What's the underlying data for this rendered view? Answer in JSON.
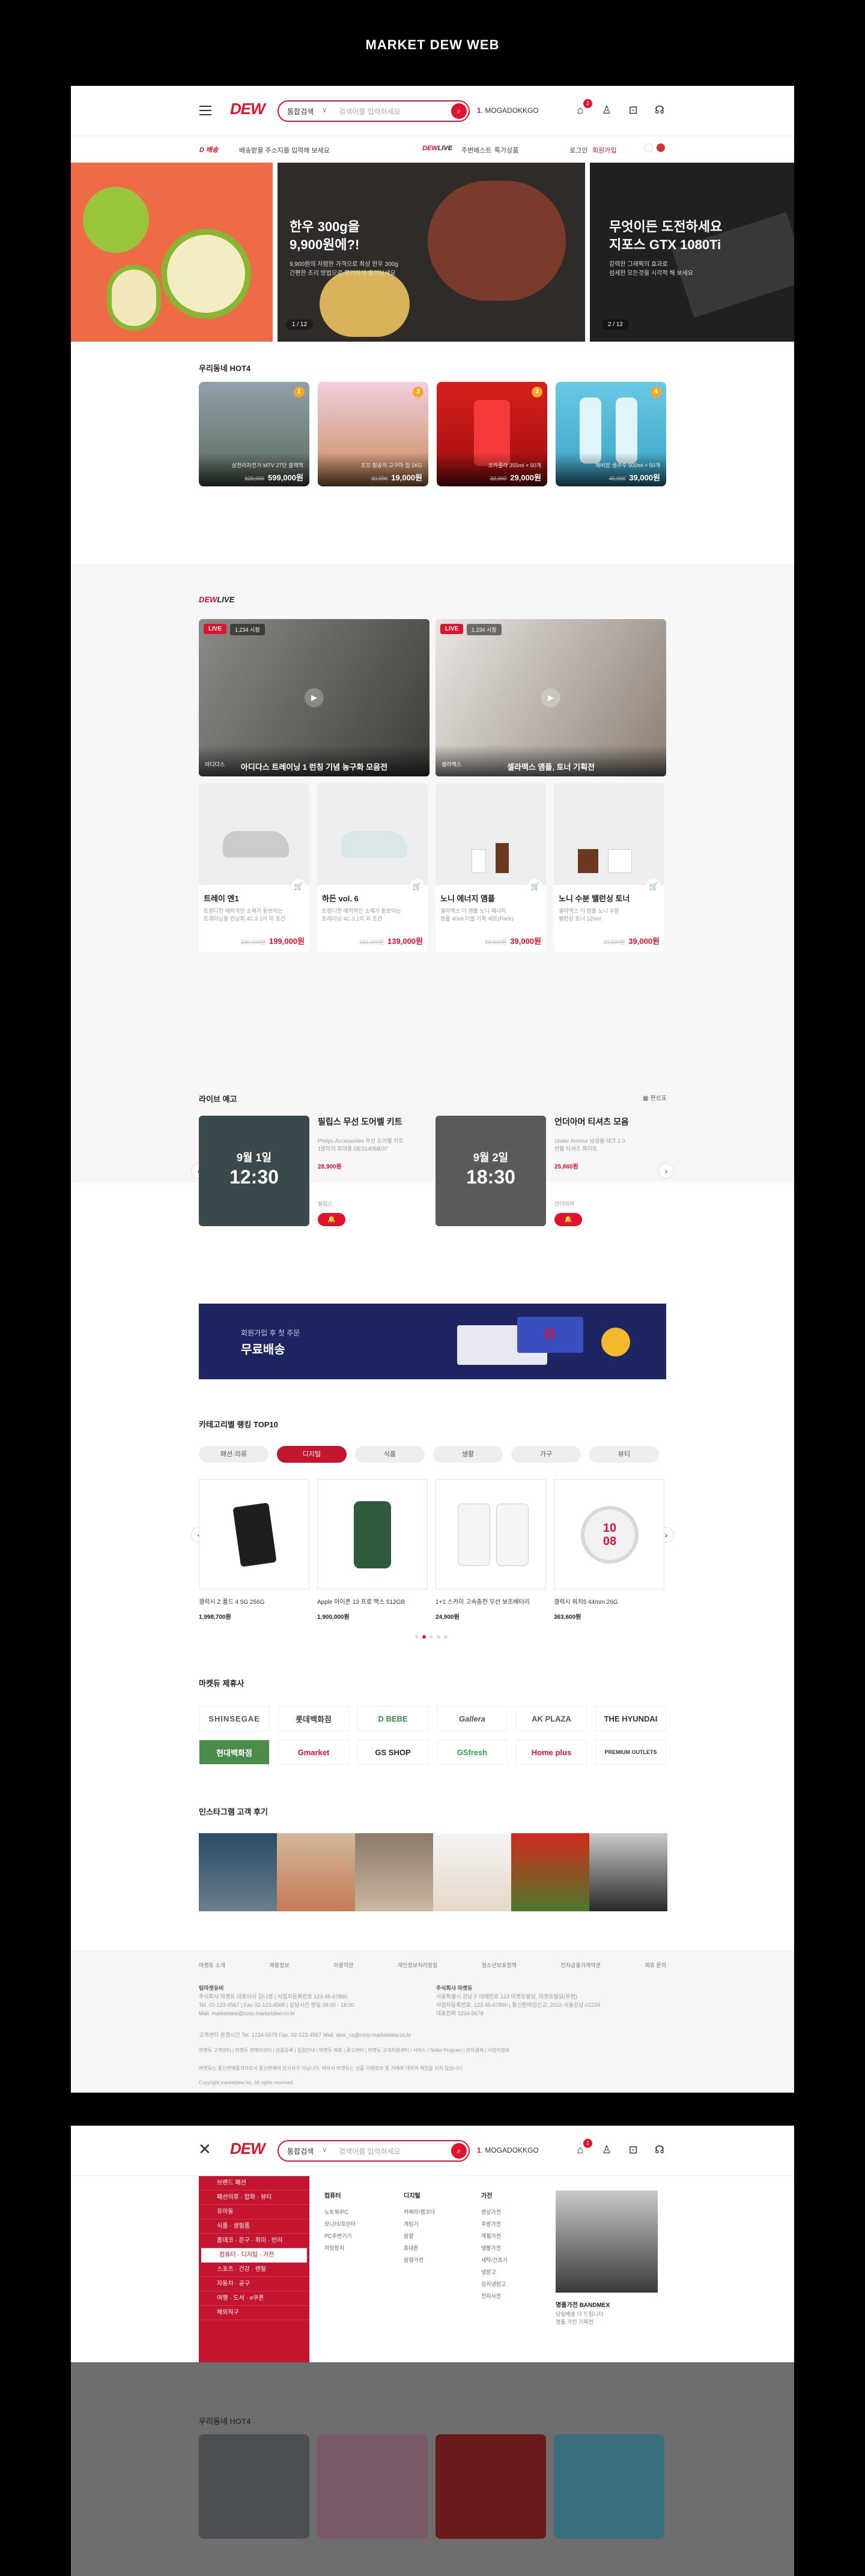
{
  "presentation_title": "MARKET DEW WEB",
  "header": {
    "logo": "DEW",
    "search_category": "통합검색",
    "search_category_arrow": "∨",
    "search_placeholder": "검색어를 입력하세요",
    "keyword_rank": "1",
    "keyword_text": "MOGADOKKGO",
    "cart_count": "2",
    "icons": [
      "bell-icon",
      "user-icon",
      "cart-icon",
      "headset-icon"
    ]
  },
  "subheader": {
    "logo": "D 배송",
    "address": "배송받을 주소지를 입력해 보세요",
    "live_logo_a": "DEW",
    "live_logo_b": "LIVE",
    "nav": [
      "주변베스트",
      "특가상품"
    ],
    "login": "로그인",
    "join": "회원가입"
  },
  "hero": {
    "slides": [
      {
        "title": "",
        "desc": "",
        "page": ""
      },
      {
        "title": "한우 300g을\n9,900원에?!",
        "desc": "9,900원의 저렴한 가격으로 최상 한우 300g\n간편한 조리 방법으로 편리하게 즐겨보세요",
        "page": "1 / 12"
      },
      {
        "title": "무엇이든 도전하세요\n지포스 GTX 1080Ti",
        "desc": "강력한 그래픽의 효과로\n섬세한 모든것을 시각적 해 보세요",
        "page": "2 / 12"
      }
    ]
  },
  "hot4": {
    "title": "우리동네 HOT4",
    "items": [
      {
        "rank": "1",
        "name": "삼천리자전거 MTV 27단 블랙텍",
        "old": "620,000",
        "price": "599,000원"
      },
      {
        "rank": "2",
        "name": "꼬꼬 칠공치 고구마 칩 1KG",
        "old": "30,000",
        "price": "19,000원"
      },
      {
        "rank": "3",
        "name": "코카콜라 355ml × 50개",
        "old": "32,000",
        "price": "29,000원"
      },
      {
        "rank": "4",
        "name": "에비앙 생수수 500ml × 50개",
        "old": "45,000",
        "price": "39,000원"
      }
    ]
  },
  "dewlive": {
    "logo_a": "DEW",
    "logo_b": "LIVE",
    "lives": [
      {
        "badge": "LIVE",
        "views": "1,234 시청",
        "title": "아디다스 트레이닝 1 런칭 기념 농구화 모음전",
        "channel": "아디다스"
      },
      {
        "badge": "LIVE",
        "views": "1,234 시청",
        "title": "셀라맥스 앰플, 토너 기획전",
        "channel": "셀라맥스"
      }
    ],
    "products": [
      {
        "name": "트레이 엔1",
        "desc": "트렌디한 매력적인 소재가 돋보이는\n트레이닝용 런닝화 4C.3.1이 외 조건",
        "old": "230,000원",
        "price": "199,000원"
      },
      {
        "name": "하든 vol. 6",
        "desc": "트렌디한 매력적인 소재가 돋보이는\n트레이닝 4C.3.1이 외 조건",
        "old": "165,000원",
        "price": "139,000원"
      },
      {
        "name": "노니 에너지 앰플",
        "desc": "셀라맥스 더 앰플 노니 에너지\n앰플 40ml 더블 기획 세트(Pack)",
        "old": "50,000원",
        "price": "39,000원"
      },
      {
        "name": "노니 수분 밸런싱 토너",
        "desc": "셀라맥스 더 앰플 노니 수분\n밸런싱 토너 120ml",
        "old": "20,000원",
        "price": "39,000원"
      }
    ]
  },
  "preview": {
    "title": "라이브 예고",
    "more": "편성표",
    "items": [
      {
        "date": "9월 1일",
        "time": "12:30",
        "title": "필립스 무선 도어벨 키트",
        "desc": "Philips Accessories 무선 도어벨 키트\n1방미치 휴대용 DES1406B/37",
        "price": "28,900원",
        "seller": "필립스",
        "alarm": "🔔"
      },
      {
        "date": "9월 2일",
        "time": "18:30",
        "title": "언더아머 티셔츠 모음",
        "desc": "Under Armour 남성용 테크 2.0\n반팔 티셔츠 화이트",
        "price": "25,860원",
        "seller": "언더아머",
        "alarm": "🔔"
      }
    ]
  },
  "banner": {
    "small": "회원가입 후 첫 주문",
    "big": "무료배송",
    "truck_label": "D"
  },
  "category": {
    "title": "카테고리별 랭킹 TOP10",
    "tabs": [
      "패션·의류",
      "디지털",
      "식품",
      "생활",
      "가구",
      "뷰티"
    ],
    "items": [
      {
        "name": "갤럭시 Z 폴드 4 5G 256G",
        "price": "1,998,700원"
      },
      {
        "name": "Apple 아이폰 13 프로 맥스 512GB",
        "price": "1,900,000원"
      },
      {
        "name": "1+1 스카이 고속충전 무선 보조배터리",
        "price": "24,900원"
      },
      {
        "name": "갤럭시 워치5 44mm 26G",
        "price": "363,600원"
      }
    ],
    "watch_text": "10\n08"
  },
  "partners": {
    "title": "마켓듀 제휴사",
    "logos": [
      "SHINSEGAE",
      "롯데백화점",
      "D BEBE",
      "Gallera",
      "AK PLAZA",
      "THE HYUNDAI",
      "현대백화점",
      "Gmarket",
      "GS SHOP",
      "GSfresh",
      "Home plus",
      "PREMIUM OUTLETS"
    ]
  },
  "instagram": {
    "title": "인스타그램 고객 후기"
  },
  "footer": {
    "nav": [
      "마켓듀 소개",
      "채용정보",
      "이용약관",
      "개인정보처리방침",
      "청소년보호정책",
      "전자금융거래약관",
      "제휴 문의"
    ],
    "company_title": "팀마켓듀비",
    "company_lines": [
      "주식회사 마켓듀 대표이사 김나영 | 사업자등록번호 123-45-67890",
      "Tel. 02-123-4567 | Fax 02-123-4568 | 상담시간 평일 09:00 - 18:00",
      "Mail. marketdew@corp.marketdew.co.kr"
    ],
    "cs_title": "주식회사 마켓듀",
    "cs_lines": [
      "서울특별시 강남구 테헤란로 123 마켓듀빌딩, 마켓듀빌딩(우편)",
      "사업자등록번호: 123-45-67890 | 통신판매업신고: 2022-서울강남-01234",
      "대표전화 1234-5678"
    ],
    "contact": "고객센터 운영시간    Tel. 1234-5678   Fax. 02-123-4567   Mail. dew_cs@corp.marketdew.co.kr",
    "links": "마켓듀 고객센터 | 마켓듀 판매자센터 | 상품등록 | 입점안내 | 마켓듀 제휴 | 광고센터 | 마켓듀 고객지원센터 | 서비스 | Seller Program | 전자결제 | 사업자정보",
    "disclaimer": "마켓듀는 통신판매중개자로서 통신판매의 당사자가 아닙니다. 따라서 마켓듀는 상품·거래정보 및 거래에 대하여 책임을 지지 않습니다.",
    "copyright": "Copyright marketdew inc. All rights reserved."
  },
  "megamenu": {
    "cats": [
      "브랜드 패션",
      "패션의류 · 잡화 · 뷰티",
      "유아동",
      "식품 · 생필품",
      "홈데코 · 문구 · 취미 · 반려",
      "컴퓨터 · 디지털 · 가전",
      "스포츠 · 건강 · 렌탈",
      "자동차 · 공구",
      "여행 · 도서 · e쿠폰",
      "해외직구"
    ],
    "columns": [
      {
        "title": "컴퓨터",
        "items": [
          "노트북/PC",
          "모니터/프린터",
          "PC주변기기",
          "저장장치"
        ]
      },
      {
        "title": "디지털",
        "items": [
          "카메라/캠코더",
          "게임기",
          "음향",
          "휴대폰",
          "음향가전"
        ]
      },
      {
        "title": "가전",
        "items": [
          "영상가전",
          "주방가전",
          "계절가전",
          "생활가전",
          "세탁/건조기",
          "냉장고",
          "김치냉장고",
          "전자사전"
        ]
      }
    ],
    "promo_title": "명품가전 BANDMEX",
    "promo_desc": "당일배송 다 드립니다\n명품 가전 기획전"
  }
}
